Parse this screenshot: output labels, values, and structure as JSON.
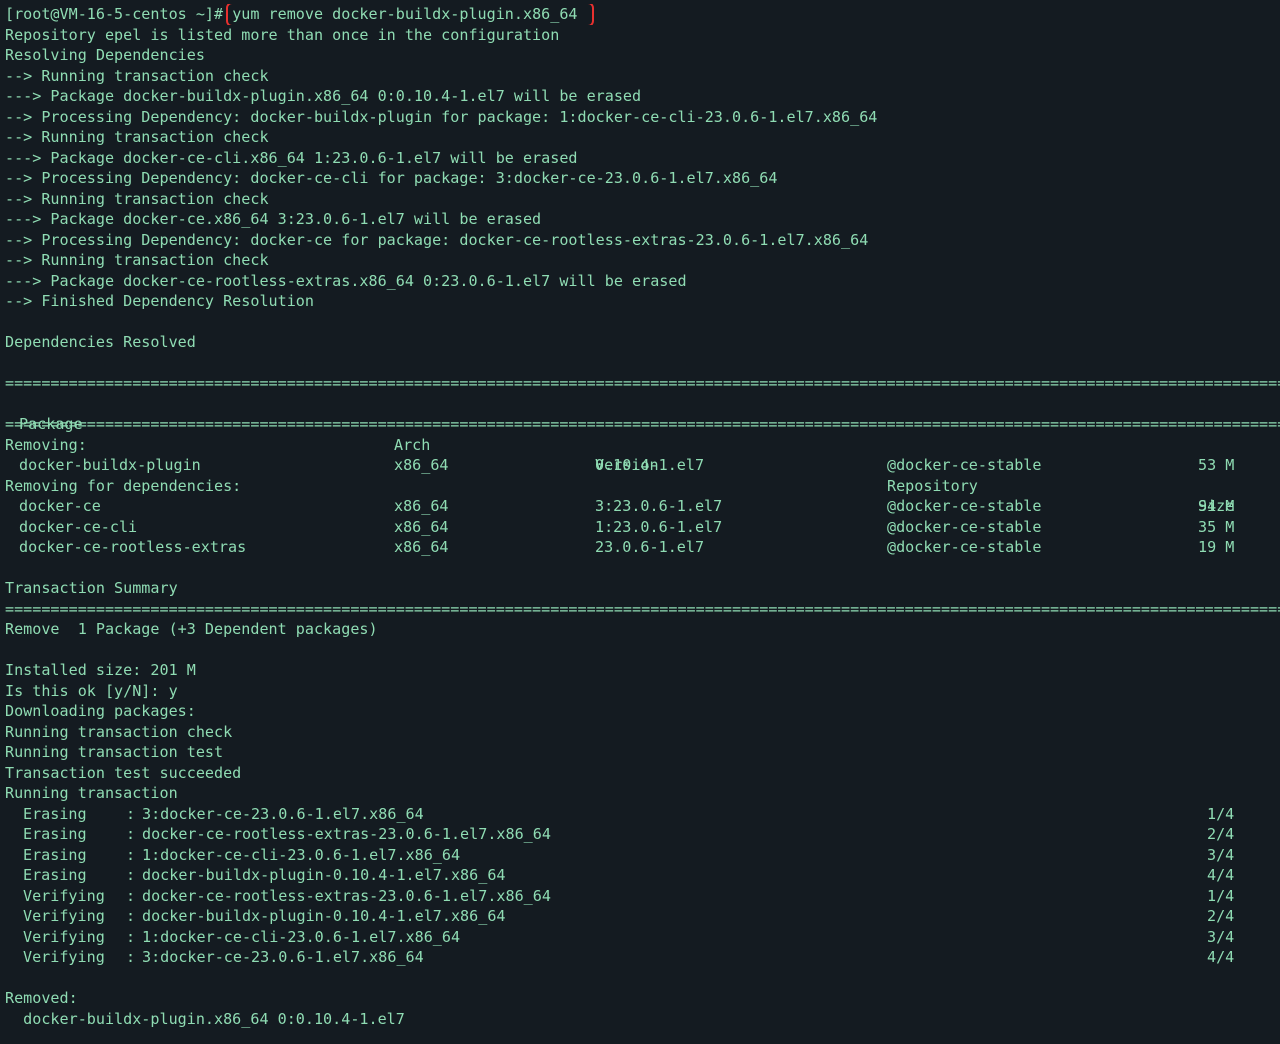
{
  "prompt": "[root@VM-16-5-centos ~]# ",
  "command": "yum remove docker-buildx-plugin.x86_64",
  "pre_lines": [
    "Repository epel is listed more than once in the configuration",
    "Resolving Dependencies",
    "--> Running transaction check",
    "---> Package docker-buildx-plugin.x86_64 0:0.10.4-1.el7 will be erased",
    "--> Processing Dependency: docker-buildx-plugin for package: 1:docker-ce-cli-23.0.6-1.el7.x86_64",
    "--> Running transaction check",
    "---> Package docker-ce-cli.x86_64 1:23.0.6-1.el7 will be erased",
    "--> Processing Dependency: docker-ce-cli for package: 3:docker-ce-23.0.6-1.el7.x86_64",
    "--> Running transaction check",
    "---> Package docker-ce.x86_64 3:23.0.6-1.el7 will be erased",
    "--> Processing Dependency: docker-ce for package: docker-ce-rootless-extras-23.0.6-1.el7.x86_64",
    "--> Running transaction check",
    "---> Package docker-ce-rootless-extras.x86_64 0:23.0.6-1.el7 will be erased",
    "--> Finished Dependency Resolution",
    "",
    "Dependencies Resolved",
    ""
  ],
  "separator": "=============================================================================================================================================",
  "table": {
    "headers": {
      "package": "Package",
      "arch": "Arch",
      "version": "Version",
      "repository": "Repository",
      "size": "Size"
    },
    "removing_label": "Removing:",
    "removing": [
      {
        "package": "docker-buildx-plugin",
        "arch": "x86_64",
        "version": "0.10.4-1.el7",
        "repository": "@docker-ce-stable",
        "size": "53 M"
      }
    ],
    "deps_label": "Removing for dependencies:",
    "deps": [
      {
        "package": "docker-ce",
        "arch": "x86_64",
        "version": "3:23.0.6-1.el7",
        "repository": "@docker-ce-stable",
        "size": "94 M"
      },
      {
        "package": "docker-ce-cli",
        "arch": "x86_64",
        "version": "1:23.0.6-1.el7",
        "repository": "@docker-ce-stable",
        "size": "35 M"
      },
      {
        "package": "docker-ce-rootless-extras",
        "arch": "x86_64",
        "version": "23.0.6-1.el7",
        "repository": "@docker-ce-stable",
        "size": "19 M"
      }
    ]
  },
  "summary_title": "Transaction Summary",
  "summary_line": "Remove  1 Package (+3 Dependent packages)",
  "post_lines": [
    "Installed size: 201 M",
    "Is this ok [y/N]: y",
    "Downloading packages:",
    "Running transaction check",
    "Running transaction test",
    "Transaction test succeeded",
    "Running transaction"
  ],
  "steps": [
    {
      "action": "Erasing",
      "package": "3:docker-ce-23.0.6-1.el7.x86_64",
      "progress": "1/4"
    },
    {
      "action": "Erasing",
      "package": "docker-ce-rootless-extras-23.0.6-1.el7.x86_64",
      "progress": "2/4"
    },
    {
      "action": "Erasing",
      "package": "1:docker-ce-cli-23.0.6-1.el7.x86_64",
      "progress": "3/4"
    },
    {
      "action": "Erasing",
      "package": "docker-buildx-plugin-0.10.4-1.el7.x86_64",
      "progress": "4/4"
    },
    {
      "action": "Verifying",
      "package": "docker-ce-rootless-extras-23.0.6-1.el7.x86_64",
      "progress": "1/4"
    },
    {
      "action": "Verifying",
      "package": "docker-buildx-plugin-0.10.4-1.el7.x86_64",
      "progress": "2/4"
    },
    {
      "action": "Verifying",
      "package": "1:docker-ce-cli-23.0.6-1.el7.x86_64",
      "progress": "3/4"
    },
    {
      "action": "Verifying",
      "package": "3:docker-ce-23.0.6-1.el7.x86_64",
      "progress": "4/4"
    }
  ],
  "removed_label": "Removed:",
  "removed_item": "  docker-buildx-plugin.x86_64 0:0.10.4-1.el7",
  "colors": {
    "background": "#141b21",
    "text": "#8fdcb3",
    "highlight_box": "#e8312f"
  }
}
